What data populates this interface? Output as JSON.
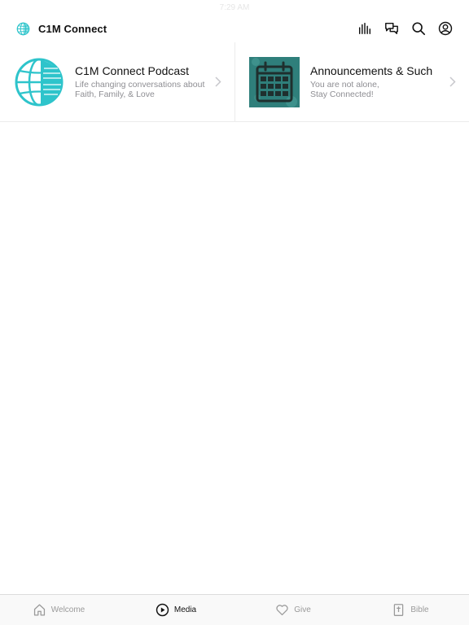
{
  "status_bar": {
    "time": "7:29 AM"
  },
  "header": {
    "title": "C1M Connect",
    "actions": [
      {
        "name": "audio-levels-icon"
      },
      {
        "name": "chat-icon"
      },
      {
        "name": "search-icon"
      },
      {
        "name": "account-icon"
      }
    ]
  },
  "cards": [
    {
      "title": "C1M Connect Podcast",
      "subtitle": "Life changing conversations about Faith, Family, & Love",
      "icon": "globe-icon"
    },
    {
      "title": "Announcements & Such",
      "subtitle": "You are not alone,\nStay Connected!",
      "icon": "calendar-icon"
    }
  ],
  "tabs": [
    {
      "label": "Welcome",
      "icon": "home-icon",
      "active": false
    },
    {
      "label": "Media",
      "icon": "play-icon",
      "active": true
    },
    {
      "label": "Give",
      "icon": "heart-icon",
      "active": false
    },
    {
      "label": "Bible",
      "icon": "bible-icon",
      "active": false
    }
  ],
  "colors": {
    "brand_teal": "#2ec4cb",
    "calendar_bg": "#2f7f7b",
    "active_tab": "#111111",
    "inactive_tab": "#9a9a9a"
  }
}
